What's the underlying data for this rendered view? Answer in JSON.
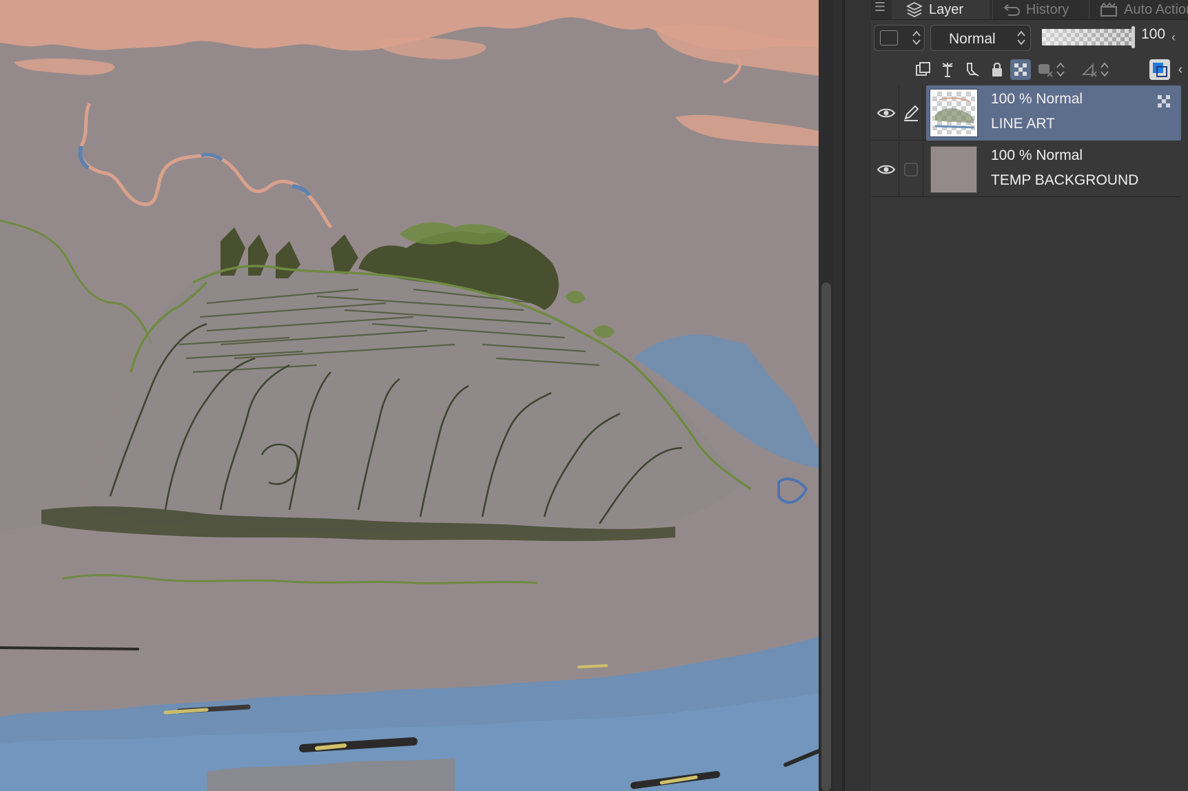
{
  "panel": {
    "tabs": [
      {
        "label": "Layer",
        "icon": "layers-icon",
        "active": true
      },
      {
        "label": "History",
        "icon": "history-icon",
        "active": false
      },
      {
        "label": "Auto Action",
        "icon": "auto-action-icon",
        "active": false
      }
    ],
    "blend_mode": "Normal",
    "opacity_value": "100"
  },
  "layers": [
    {
      "mode": "100 % Normal",
      "name": "LINE ART",
      "selected": true,
      "visible": true,
      "editing": true
    },
    {
      "mode": "100 % Normal",
      "name": "TEMP BACKGROUND",
      "selected": false,
      "visible": true,
      "editing": false
    }
  ],
  "colors": {
    "canvas_bg": "#958a8b",
    "sky_pink": "#d9a18d",
    "line_green": "#5d7a38",
    "dark_green": "#48502f",
    "water_blue": "#6a8fb8",
    "selection": "#5d6d8c"
  }
}
